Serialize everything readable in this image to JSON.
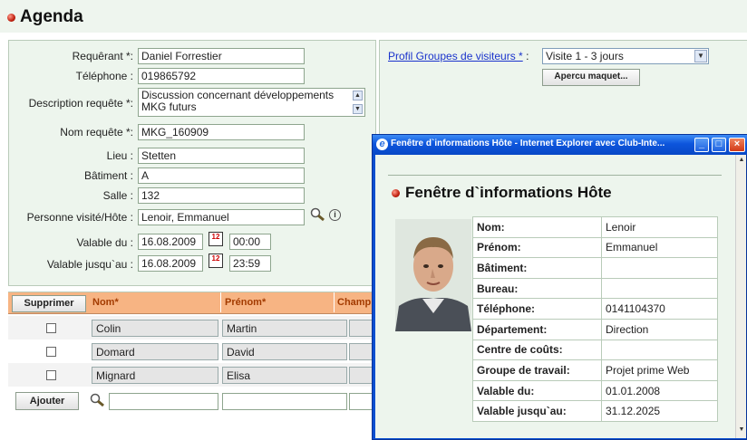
{
  "page": {
    "title": "Agenda"
  },
  "form": {
    "requerant_label": "Requêrant *:",
    "requerant_value": "Daniel Forrestier",
    "telephone_label": "Téléphone :",
    "telephone_value": "019865792",
    "description_label": "Description requête *:",
    "description_value_line1": "Discussion concernant développements",
    "description_value_line2": "MKG futurs",
    "nom_requete_label": "Nom requête *:",
    "nom_requete_value": "MKG_160909",
    "lieu_label": "Lieu :",
    "lieu_value": "Stetten",
    "batiment_label": "Bâtiment :",
    "batiment_value": "A",
    "salle_label": "Salle :",
    "salle_value": "132",
    "personne_label": "Personne visité/Hôte :",
    "personne_value": "Lenoir, Emmanuel",
    "valable_du_label": "Valable du :",
    "valable_du_date": "16.08.2009",
    "valable_du_time": "00:00",
    "valable_jusqu_label": "Valable jusqu`au :",
    "valable_jusqu_date": "16.08.2009",
    "valable_jusqu_time": "23:59",
    "calendar_glyph": "12"
  },
  "profile": {
    "link_label": "Profil Groupes de visiteurs *",
    "colon": ":",
    "select_value": "Visite 1 - 3 jours",
    "preview_button": "Apercu maquet..."
  },
  "grid": {
    "headers": [
      "Supprimer",
      "Nom*",
      "Prénom*",
      "Champ"
    ],
    "rows": [
      {
        "nom": "Colin",
        "prenom": "Martin"
      },
      {
        "nom": "Domard",
        "prenom": "David"
      },
      {
        "nom": "Mignard",
        "prenom": "Elisa"
      }
    ],
    "add_button": "Ajouter"
  },
  "popup": {
    "window_title": "Fenêtre d`informations Hôte - Internet Explorer avec Club-Inte...",
    "heading": "Fenêtre d`informations Hôte",
    "fields": [
      {
        "key": "Nom:",
        "value": "Lenoir"
      },
      {
        "key": "Prénom:",
        "value": "Emmanuel"
      },
      {
        "key": "Bâtiment:",
        "value": ""
      },
      {
        "key": "Bureau:",
        "value": ""
      },
      {
        "key": "Téléphone:",
        "value": "0141104370"
      },
      {
        "key": "Département:",
        "value": "Direction"
      },
      {
        "key": "Centre de coûts:",
        "value": ""
      },
      {
        "key": "Groupe de travail:",
        "value": "Projet prime Web"
      },
      {
        "key": "Valable du:",
        "value": "01.01.2008"
      },
      {
        "key": "Valable jusqu`au:",
        "value": "31.12.2025"
      }
    ]
  },
  "icons": {
    "search": "magnifier-icon",
    "info": "info-icon",
    "minimize": "minimize-icon",
    "maximize": "maximize-icon",
    "close": "close-icon"
  },
  "colors": {
    "panel_bg": "#edf5ed",
    "grid_header": "#f7b483",
    "ie_titlebar": "#0d55dc",
    "close_button": "#e0442a"
  }
}
